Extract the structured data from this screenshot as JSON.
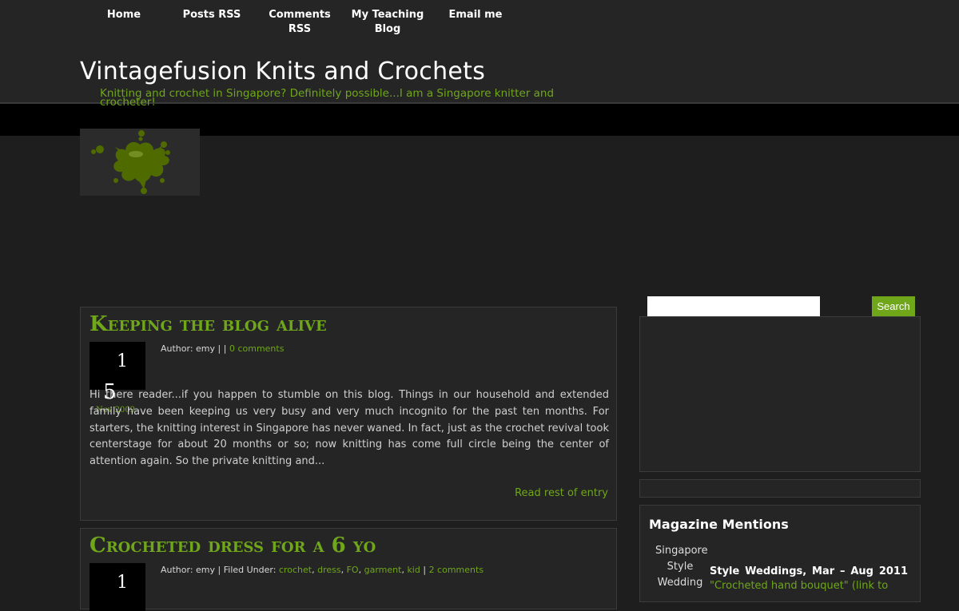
{
  "nav": {
    "items": [
      {
        "label": "Home"
      },
      {
        "label": "Posts RSS"
      },
      {
        "label": "Comments RSS"
      },
      {
        "label": "My Teaching Blog"
      },
      {
        "label": "Email me"
      }
    ]
  },
  "header": {
    "title": "Vintagefusion Knits and Crochets",
    "tagline": "Knitting and crochet in Singapore? Definitely possible...I am a Singapore knitter and crocheter!"
  },
  "colors": {
    "accent": "#6fa61a",
    "background": "#1e1e1e",
    "panel": "#252525"
  },
  "posts": [
    {
      "title": "Keeping the blog alive",
      "date_day": "1",
      "date_day2": "5",
      "date_month": "Nov 2009",
      "author_prefix": "Author: emy | |",
      "comments": "0 comments",
      "excerpt": "Hi there reader...if you happen to stumble on this blog. Things in our household and extended family have been keeping us very busy and very much incognito for the past ten months. For starters, the knitting interest in Singapore has never waned. In fact, just as the crochet revival took centerstage for about 20 months or so; now knitting has come full circle being the center of attention again. So the private knitting and...",
      "read_more": "Read rest of entry"
    },
    {
      "title": "Crocheted dress for a 6 yo",
      "date_day": "1",
      "author_prefix": "Author: emy | Filed Under:",
      "tags": [
        "crochet",
        "dress",
        "FO",
        "garment",
        "kid"
      ],
      "comments": "2 comments"
    }
  ],
  "sidebar": {
    "search_button": "Search",
    "search_value": "",
    "magazine": {
      "title": "Magazine Mentions",
      "image_alt": "Singapore Style Wedding",
      "text": "Style Weddings, Mar – Aug 2011",
      "link": "\"Crocheted hand bouquet\" (link to"
    }
  }
}
